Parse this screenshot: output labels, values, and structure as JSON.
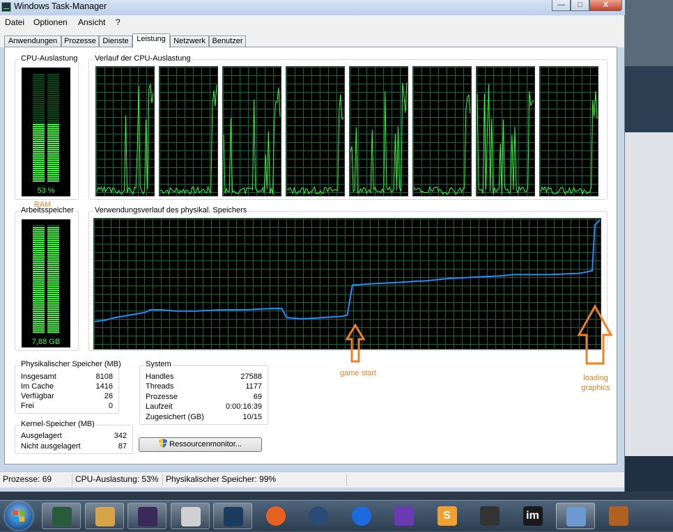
{
  "window": {
    "title": "Windows Task-Manager",
    "controls": {
      "minimize": "—",
      "maximize": "□",
      "close": "X"
    }
  },
  "menu": [
    "Datei",
    "Optionen",
    "Ansicht",
    "?"
  ],
  "tabs": [
    "Anwendungen",
    "Prozesse",
    "Dienste",
    "Leistung",
    "Netzwerk",
    "Benutzer"
  ],
  "active_tab": "Leistung",
  "cpu": {
    "group_label": "CPU-Auslastung",
    "value_text": "53 %",
    "level": 0.53,
    "history_label": "Verlauf der CPU-Auslastung",
    "core_count": 8
  },
  "memory": {
    "group_label": "Arbeitsspeicher",
    "value_text": "7,88 GB",
    "level": 0.99,
    "history_label": "Verwendungsverlauf des physikal. Speichers"
  },
  "physical_memory": {
    "label": "Physikalischer Speicher (MB)",
    "rows": [
      {
        "k": "Insgesamt",
        "v": "8108"
      },
      {
        "k": "Im Cache",
        "v": "1416"
      },
      {
        "k": "Verfügbar",
        "v": "26"
      },
      {
        "k": "Frei",
        "v": "0"
      }
    ]
  },
  "kernel_memory": {
    "label": "Kernel-Speicher (MB)",
    "rows": [
      {
        "k": "Ausgelagert",
        "v": "342"
      },
      {
        "k": "Nicht ausgelagert",
        "v": "87"
      }
    ]
  },
  "system": {
    "label": "System",
    "rows": [
      {
        "k": "Handles",
        "v": "27588"
      },
      {
        "k": "Threads",
        "v": "1177"
      },
      {
        "k": "Prozesse",
        "v": "69"
      },
      {
        "k": "Laufzeit",
        "v": "0:00:16:39"
      },
      {
        "k": "Zugesichert (GB)",
        "v": "10/15"
      }
    ]
  },
  "resource_monitor_button": "Ressourcenmonitor...",
  "statusbar": {
    "processes": "Prozesse: 69",
    "cpu": "CPU-Auslastung: 53%",
    "memory": "Physikalischer Speicher: 99%"
  },
  "annotations": {
    "ram": "RAM",
    "game_start": "game start",
    "loading_graphics_1": "loading",
    "loading_graphics_2": "graphics"
  },
  "colors": {
    "graph_bg": "#000000",
    "grid": "#0b6b3c",
    "cpu_line": "#33ff33",
    "memory_line": "#1e90ff",
    "annotation": "#f08020"
  },
  "taskbar": {
    "icons": [
      "task-manager-icon",
      "file-explorer-icon",
      "app-icon",
      "foobar-icon",
      "steam-icon",
      "firefox-icon",
      "keepass-icon",
      "keyboard-icon",
      "visual-studio-icon",
      "sublime-text-icon",
      "bug-icon",
      "im-icon",
      "paint-icon",
      "settings-gear-icon"
    ],
    "im_text": "im",
    "sublime_text": "S"
  }
}
